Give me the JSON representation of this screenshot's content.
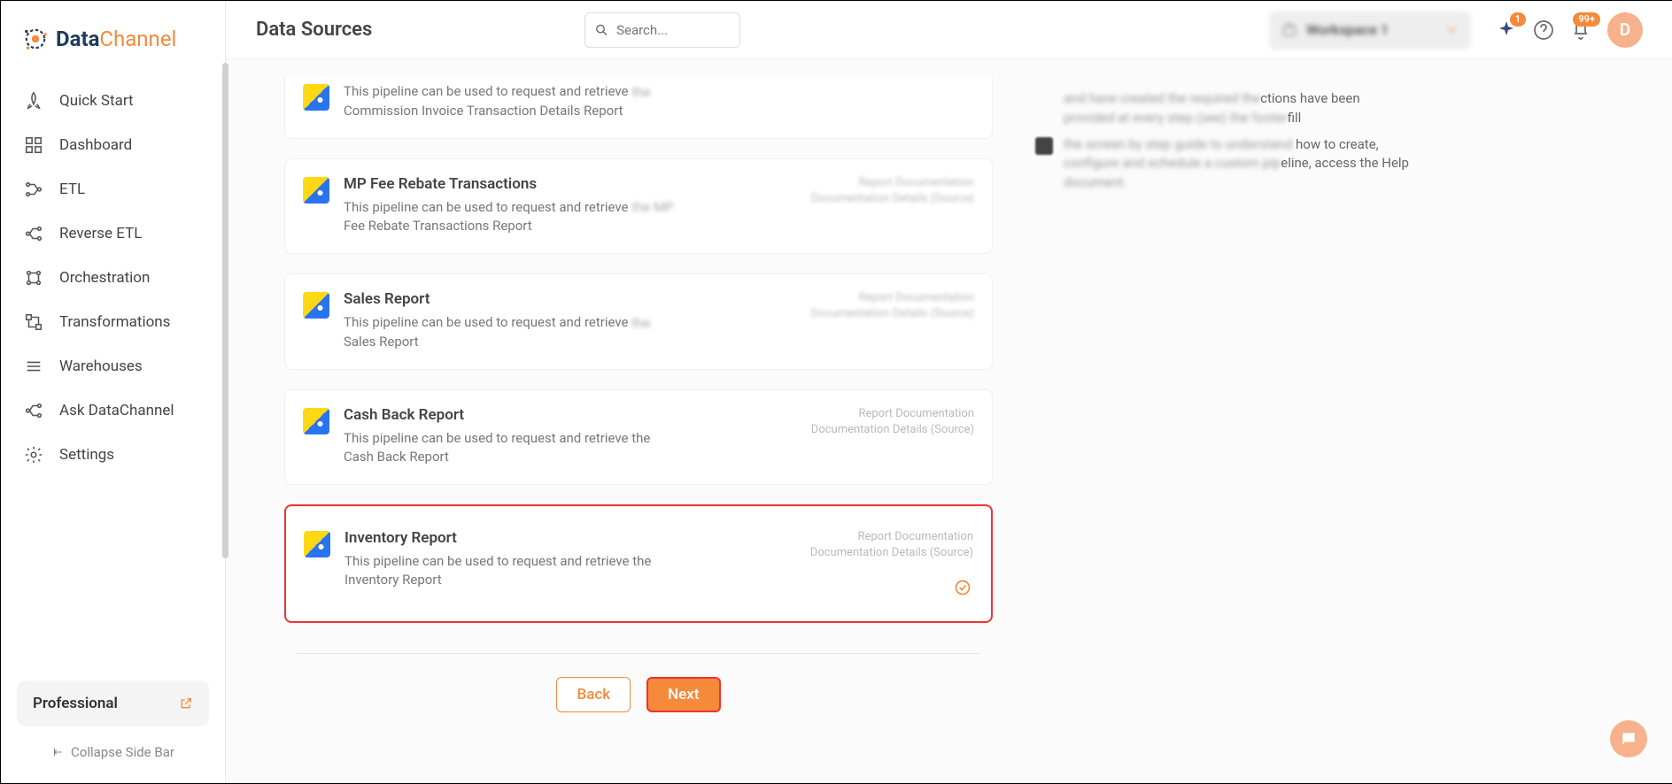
{
  "brand": {
    "name_a": "Data",
    "name_b": "Channel"
  },
  "sidebar": {
    "items": [
      {
        "label": "Quick Start"
      },
      {
        "label": "Dashboard"
      },
      {
        "label": "ETL"
      },
      {
        "label": "Reverse ETL"
      },
      {
        "label": "Orchestration"
      },
      {
        "label": "Transformations"
      },
      {
        "label": "Warehouses"
      },
      {
        "label": "Ask DataChannel"
      },
      {
        "label": "Settings"
      }
    ],
    "plan": "Professional",
    "collapse": "Collapse Side Bar"
  },
  "header": {
    "title": "Data Sources",
    "search_placeholder": "Search...",
    "workspace": "Workspace 1",
    "badge_sparkle": "1",
    "badge_bell": "99+",
    "avatar": "D"
  },
  "cards": [
    {
      "title": "",
      "desc_a": "This pipeline can be used to request and retrieve",
      "desc_blur": "the",
      "desc_b": "Commission Invoice Transaction Details Report",
      "doc1": "",
      "doc2": ""
    },
    {
      "title": "MP Fee Rebate Transactions",
      "desc_a": "This pipeline can be used to request and retrieve",
      "desc_blur": "the MP",
      "desc_b": "Fee Rebate Transactions Report",
      "doc1": "Report Documentation",
      "doc2": "Documentation Details (Source)"
    },
    {
      "title": "Sales Report",
      "desc_a": "This pipeline can be used to request and retrieve",
      "desc_blur": "the",
      "desc_b": "Sales Report",
      "doc1": "Report Documentation",
      "doc2": "Documentation Details (Source)"
    },
    {
      "title": "Cash Back Report",
      "desc_a": "This pipeline can be used to request and retrieve the",
      "desc_blur": "",
      "desc_b": "Cash Back Report",
      "doc1": "Report Documentation",
      "doc2": "Documentation Details (Source)"
    },
    {
      "title": "Inventory Report",
      "desc_a": "This pipeline can be used to request and retrieve the",
      "desc_blur": "",
      "desc_b": "Inventory Report",
      "doc1": "Report Documentation",
      "doc2": "Documentation Details (Source)"
    }
  ],
  "info": {
    "r1_blur": "and have created the required the",
    "r1_tail": "ctions have been",
    "r1b_blur": "provided at every step (see) the footer",
    "r1b_tail": "fill",
    "r2_blur": "the screen by step guide to understand",
    "r2_tail": " how to create,",
    "r2b_blur": "configure and schedule a custom pip",
    "r2b_tail": "eline, access the Help",
    "r2c_blur": "document."
  },
  "actions": {
    "back": "Back",
    "next": "Next"
  }
}
